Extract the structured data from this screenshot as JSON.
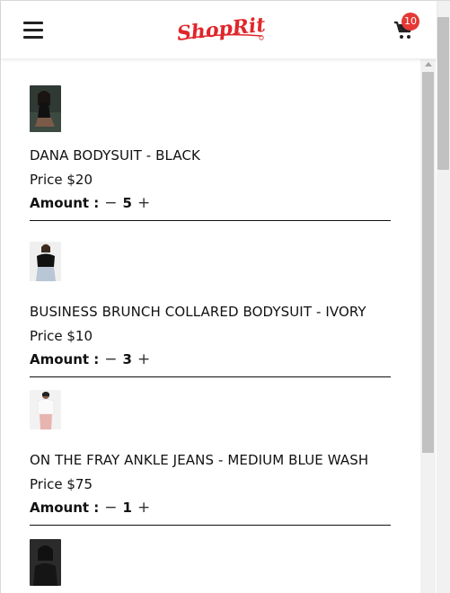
{
  "header": {
    "logo_text": "ShopRite",
    "cart_count": "10",
    "colors": {
      "brand": "#e0262b",
      "badge": "#e53935"
    }
  },
  "cart": {
    "amount_label": "Amount :",
    "minus_symbol": "−",
    "plus_symbol": "+",
    "items": [
      {
        "name": "DANA BODYSUIT - BLACK",
        "price": "Price $20",
        "quantity": "5"
      },
      {
        "name": "BUSINESS BRUNCH COLLARED BODYSUIT - IVORY",
        "price": "Price $10",
        "quantity": "3"
      },
      {
        "name": "ON THE FRAY ANKLE JEANS - MEDIUM BLUE WASH",
        "price": "Price $75",
        "quantity": "1"
      }
    ]
  }
}
